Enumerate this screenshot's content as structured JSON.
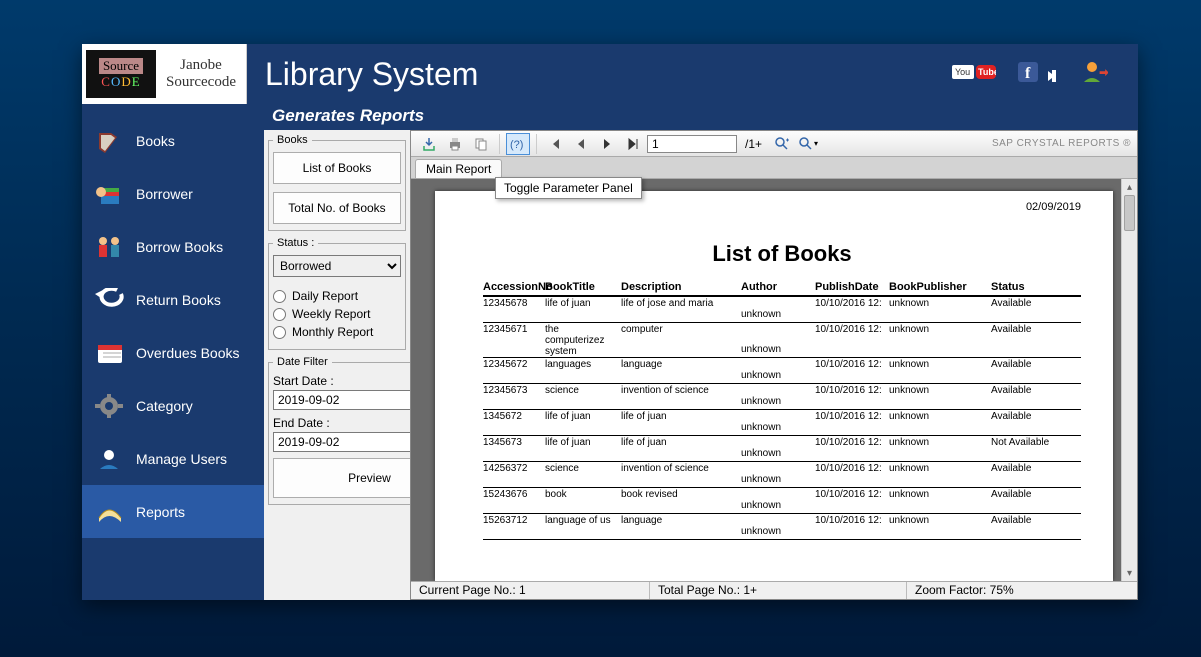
{
  "logo": {
    "name_line1": "Janobe",
    "name_line2": "Sourcecode",
    "src_text": "Source",
    "code_text": "CODE"
  },
  "app_title": "Library System",
  "subheading": "Generates Reports",
  "nav": [
    {
      "label": "Books"
    },
    {
      "label": "Borrower"
    },
    {
      "label": "Borrow Books"
    },
    {
      "label": "Return Books"
    },
    {
      "label": "Overdues Books"
    },
    {
      "label": "Category"
    },
    {
      "label": "Manage Users"
    },
    {
      "label": "Reports"
    }
  ],
  "books_box": {
    "legend": "Books",
    "btn1": "List of Books",
    "btn2": "Total No. of Books"
  },
  "status_box": {
    "legend": "Status :",
    "selected": "Borrowed",
    "radio1": "Daily Report",
    "radio2": "Weekly Report",
    "radio3": "Monthly Report"
  },
  "date_filter": {
    "legend": "Date Filter",
    "start_label": "Start Date :",
    "start_value": "2019-09-02",
    "end_label": "End Date :",
    "end_value": "2019-09-02",
    "preview": "Preview"
  },
  "toolbar": {
    "page_value": "1",
    "page_total": "/1+",
    "brand": "SAP CRYSTAL REPORTS ®"
  },
  "tab": "Main Report",
  "tooltip": "Toggle Parameter Panel",
  "report": {
    "date": "02/09/2019",
    "title": "List of Books",
    "headers": [
      "AccessionNo",
      "BookTitle",
      "Description",
      "Author",
      "PublishDate",
      "BookPublisher",
      "Status"
    ],
    "rows": [
      {
        "acc": "12345678",
        "title": "life of juan",
        "desc": "life of jose and maria",
        "author": "unknown",
        "pub": "10/10/2016 12:",
        "publisher": "unknown",
        "status": "Available"
      },
      {
        "acc": "12345671",
        "title": "the computerizez system",
        "desc": "computer",
        "author": "unknown",
        "pub": "10/10/2016 12:",
        "publisher": "unknown",
        "status": "Available"
      },
      {
        "acc": "12345672",
        "title": "languages",
        "desc": "language",
        "author": "unknown",
        "pub": "10/10/2016 12:",
        "publisher": "unknown",
        "status": "Available"
      },
      {
        "acc": "12345673",
        "title": "science",
        "desc": "invention of science",
        "author": "unknown",
        "pub": "10/10/2016 12:",
        "publisher": "unknown",
        "status": "Available"
      },
      {
        "acc": "1345672",
        "title": "life of juan",
        "desc": "life of juan",
        "author": "unknown",
        "pub": "10/10/2016 12:",
        "publisher": "unknown",
        "status": "Available"
      },
      {
        "acc": "1345673",
        "title": "life of juan",
        "desc": "life of juan",
        "author": "unknown",
        "pub": "10/10/2016 12:",
        "publisher": "unknown",
        "status": "Not Available"
      },
      {
        "acc": "14256372",
        "title": "science",
        "desc": "invention of science",
        "author": "unknown",
        "pub": "10/10/2016 12:",
        "publisher": "unknown",
        "status": "Available"
      },
      {
        "acc": "15243676",
        "title": "book",
        "desc": "book revised",
        "author": "unknown",
        "pub": "10/10/2016 12:",
        "publisher": "unknown",
        "status": "Available"
      },
      {
        "acc": "15263712",
        "title": "language of us",
        "desc": "language",
        "author": "unknown",
        "pub": "10/10/2016 12:",
        "publisher": "unknown",
        "status": "Available"
      }
    ]
  },
  "statusbar": {
    "current": "Current Page No.: 1",
    "total": "Total Page No.: 1+",
    "zoom": "Zoom Factor: 75%"
  }
}
